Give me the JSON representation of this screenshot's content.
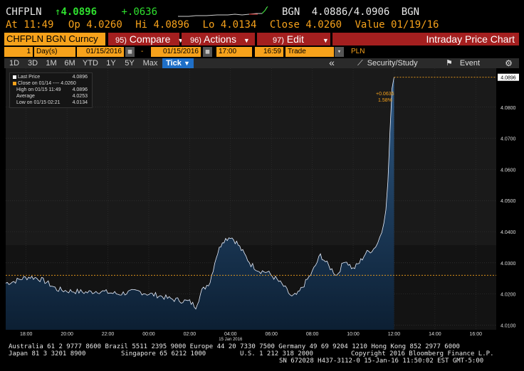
{
  "header": {
    "ticker": "CHFPLN",
    "arrow": "↑",
    "last": "4.0896",
    "change": "+.0636",
    "source": "BGN",
    "bid_ask": "4.0886/4.0906",
    "source2": "BGN",
    "at_label": "At",
    "at_time": "11:49",
    "op_label": "Op",
    "op_value": "4.0260",
    "hi_label": "Hi",
    "hi_value": "4.0896",
    "lo_label": "Lo",
    "lo_value": "4.0134",
    "close_label": "Close",
    "close_value": "4.0260",
    "value_label": "Value",
    "value_date": "01/19/16"
  },
  "toolbar": {
    "security": "CHFPLN BGN Curncy",
    "compare_num": "95)",
    "compare": "Compare",
    "actions_num": "96)",
    "actions": "Actions",
    "edit_num": "97)",
    "edit": "Edit",
    "chart_title": "Intraday Price Chart"
  },
  "params": {
    "period_count": "1",
    "period_unit": "Day(s)",
    "start_date": "01/15/2016",
    "dash": "-",
    "end_date": "01/15/2016",
    "start_time": "17:00",
    "end_time": "16:59",
    "field": "Trade",
    "currency": "PLN"
  },
  "ranges": [
    "1D",
    "3D",
    "1M",
    "6M",
    "YTD",
    "1Y",
    "5Y",
    "Max"
  ],
  "tick_label": "Tick",
  "tools": {
    "back": "«",
    "security_study": "Security/Study",
    "event": "Event"
  },
  "legend": {
    "rows": [
      {
        "label": "Last Price",
        "value": "4.0896",
        "color": "#ffffff"
      },
      {
        "label": "Close on 01/14 ---- 4.0260",
        "value": "",
        "color": "#f7a21b"
      },
      {
        "label": "High on 01/15 11:49",
        "value": "4.0896",
        "color": ""
      },
      {
        "label": "Average",
        "value": "4.0253",
        "color": ""
      },
      {
        "label": "Low on 01/15 02:21",
        "value": "4.0134",
        "color": ""
      }
    ]
  },
  "annotation": {
    "change": "+0.0636",
    "pct": "1.58%"
  },
  "chart_data": {
    "type": "area",
    "ylim": [
      4.0085,
      4.0925
    ],
    "y_ticks": [
      4.01,
      4.02,
      4.03,
      4.04,
      4.05,
      4.06,
      4.07,
      4.08
    ],
    "y_tick_labels": [
      "4.0100",
      "4.0200",
      "4.0300",
      "4.0400",
      "4.0500",
      "4.0600",
      "4.0700",
      "4.0800"
    ],
    "last_label": "4.0896",
    "x_tick_labels": [
      "18:00",
      "20:00",
      "22:00",
      "00:00",
      "02:00",
      "04:00",
      "06:00",
      "08:00",
      "10:00",
      "12:00",
      "14:00",
      "16:00"
    ],
    "x_tick_hours": [
      1,
      3,
      5,
      7,
      9,
      11,
      13,
      15,
      17,
      19,
      21,
      23
    ],
    "x_date_label": "15 Jan 2016",
    "x_date_hour": 11,
    "close_ref": 4.026,
    "series": [
      {
        "x": [
          0,
          0.4,
          0.8,
          1.2,
          1.6,
          2,
          2.5,
          3,
          3.5,
          4,
          4.5,
          5,
          5.5,
          6,
          6.5,
          7,
          7.5,
          8,
          8.5,
          9,
          9.3,
          9.6,
          10,
          10.3,
          10.6,
          11,
          11.3,
          11.6,
          12,
          12.4,
          12.8,
          13.2,
          13.6,
          14,
          14.3,
          14.6,
          15,
          15.4,
          15.8,
          16.2,
          16.6,
          17,
          17.3,
          17.6,
          18,
          18.2,
          18.4,
          18.6,
          18.7,
          18.8,
          18.9,
          19.0
        ],
        "y": [
          4.0235,
          4.024,
          4.025,
          4.0255,
          4.025,
          4.0238,
          4.0215,
          4.021,
          4.0208,
          4.0205,
          4.021,
          4.0205,
          4.02,
          4.0205,
          4.0208,
          4.02,
          4.0195,
          4.0185,
          4.018,
          4.0175,
          4.016,
          4.021,
          4.024,
          4.032,
          4.037,
          4.0385,
          4.0365,
          4.0335,
          4.0295,
          4.0275,
          4.027,
          4.025,
          4.0225,
          4.019,
          4.02,
          4.023,
          4.027,
          4.0325,
          4.029,
          4.026,
          4.031,
          4.028,
          4.03,
          4.033,
          4.0345,
          4.0365,
          4.04,
          4.047,
          4.056,
          4.072,
          4.086,
          4.0896
        ]
      }
    ]
  },
  "footer": {
    "line1": "Australia 61 2 9777 8600 Brazil 5511 2395 9000 Europe 44 20 7330 7500 Germany 49 69 9204 1210 Hong Kong 852 2977 6000",
    "line2a": "Japan 81 3 3201 8900",
    "line2b": "Singapore 65 6212 1000",
    "line2c": "U.S. 1 212 318 2000",
    "line2d": "Copyright 2016 Bloomberg Finance L.P.",
    "line3": "SN 672028 H437-3112-0 15-Jan-16 11:50:02 EST  GMT-5:00"
  },
  "colors": {
    "accent": "#f7a21b",
    "toolbar_red": "#a41f1f",
    "area_top": "#2f5a86",
    "area_bottom": "#0c1f33",
    "line": "#e8f0ff"
  }
}
